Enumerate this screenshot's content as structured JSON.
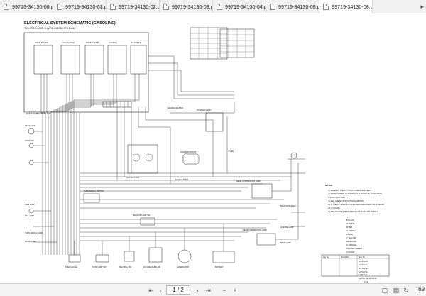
{
  "tabs": [
    {
      "label": "99719-34130-00.pdf",
      "active": false
    },
    {
      "label": "99719-34130-01.pdf",
      "active": false
    },
    {
      "label": "99719-34130-02.pdf",
      "active": false
    },
    {
      "label": "99719-34130-03.pdf",
      "active": false
    },
    {
      "label": "99719-34130-04.pdf",
      "active": false
    },
    {
      "label": "99719-34130-05.pdf",
      "active": false
    },
    {
      "label": "99719-34130-06.pdf",
      "active": true
    }
  ],
  "document": {
    "title": "ELECTRICAL SYSTEM SCHEMATIC (GASOLINE)",
    "subtitle": "TOYOTA'S MOD. 5 WIRE DIESEL 370 BUILT",
    "notes_heading": "NOTES",
    "notes": [
      "(1) REFER TO THE TOYOTA DISTRIBUTOR MODELS.",
      "(2) ARRANGEMENT OF TERMINALS IN BOARD OF CONNECTOR",
      "    SHOWN HOLD SIDE",
      "(3) RED LINE SHOWS (OPTIONAL WIRING).",
      "(4) IN USE OF SENSOR IN SPECIFIED WIRE (DIAMETER SHALL BE",
      "    AS (*) FIGURE",
      "(5) THIS FIGURE SHOWS WIRING FOR GASOLINE MODELS."
    ],
    "color_codes": [
      "B    BLACK",
      "W    WHITE",
      "R    RED",
      "G    GREEN",
      "L    BLUE",
      "Y    YELLOW",
      "BR   BROWN",
      "O    ORANGE",
      "LG   LIGHT GREEN",
      "V    VIOLET"
    ],
    "components": {
      "front_combination_lamp": "FRONT COMBINATION LAMP",
      "head_lamp": "HEAD LAMP",
      "horn_sw": "HORN SW",
      "fuel_gauge": "FUEL GAUGE",
      "engine_ground": "ENGINE GROUND",
      "starter_relay": "STARTER RELAY",
      "starter_motor": "STARTER MOTOR",
      "ignition_coil": "IGNITION COIL",
      "rear_combination_lamp_lh": "REAR COMBINATION LAMP",
      "rear_combination_lamp_rh": "REAR COMBINATION LAMP",
      "backup_buzzer": "BACKUP BUZZER",
      "license_lamp": "LICENSE LAMP",
      "alternator": "ALTERNATOR",
      "battery": "BATTERY",
      "fuel_sender": "FUEL SENDER",
      "oil_pressure_sw": "OIL PRESSURE SW",
      "neutral_sw": "NEUTRAL SW",
      "stop_lamp_sw": "STOP LAMP SW",
      "turn_signal_sw": "TURN SIGNAL SWITCH",
      "tail_lamp_lh": "TAIL LAMP",
      "side_lamp": "SIDE LAMP",
      "work_lamp": "WORK LAMP",
      "turn_signal_lamp": "TURN SIGNAL LAMP",
      "back_lamp": "BACK LAMP",
      "backup_lamp_sw": "BACKUP LAMP SW",
      "main_fuse": "FUSE"
    },
    "gauge_boxes": [
      "HOUR METER",
      "FUEL GAUGE",
      "WATER TEMP",
      "CHARGE",
      "OIL PRESS"
    ],
    "parts_table": {
      "header": [
        "Part No.",
        "Description",
        "Spec No."
      ],
      "rows": [
        [
          "",
          "",
          "S-87133-60-a"
        ],
        [
          "",
          "",
          "S-87133-61-a"
        ],
        [
          "",
          "",
          "S-87133-62-a"
        ],
        [
          "",
          "",
          "S-87133-63-a"
        ],
        [
          "",
          "",
          "S-87133-64-a"
        ]
      ]
    },
    "footer": "Pub.No. 99719-34130",
    "page_mark": "2-13"
  },
  "toolbar": {
    "page_indicator": "1 / 2",
    "zoom": "69"
  }
}
